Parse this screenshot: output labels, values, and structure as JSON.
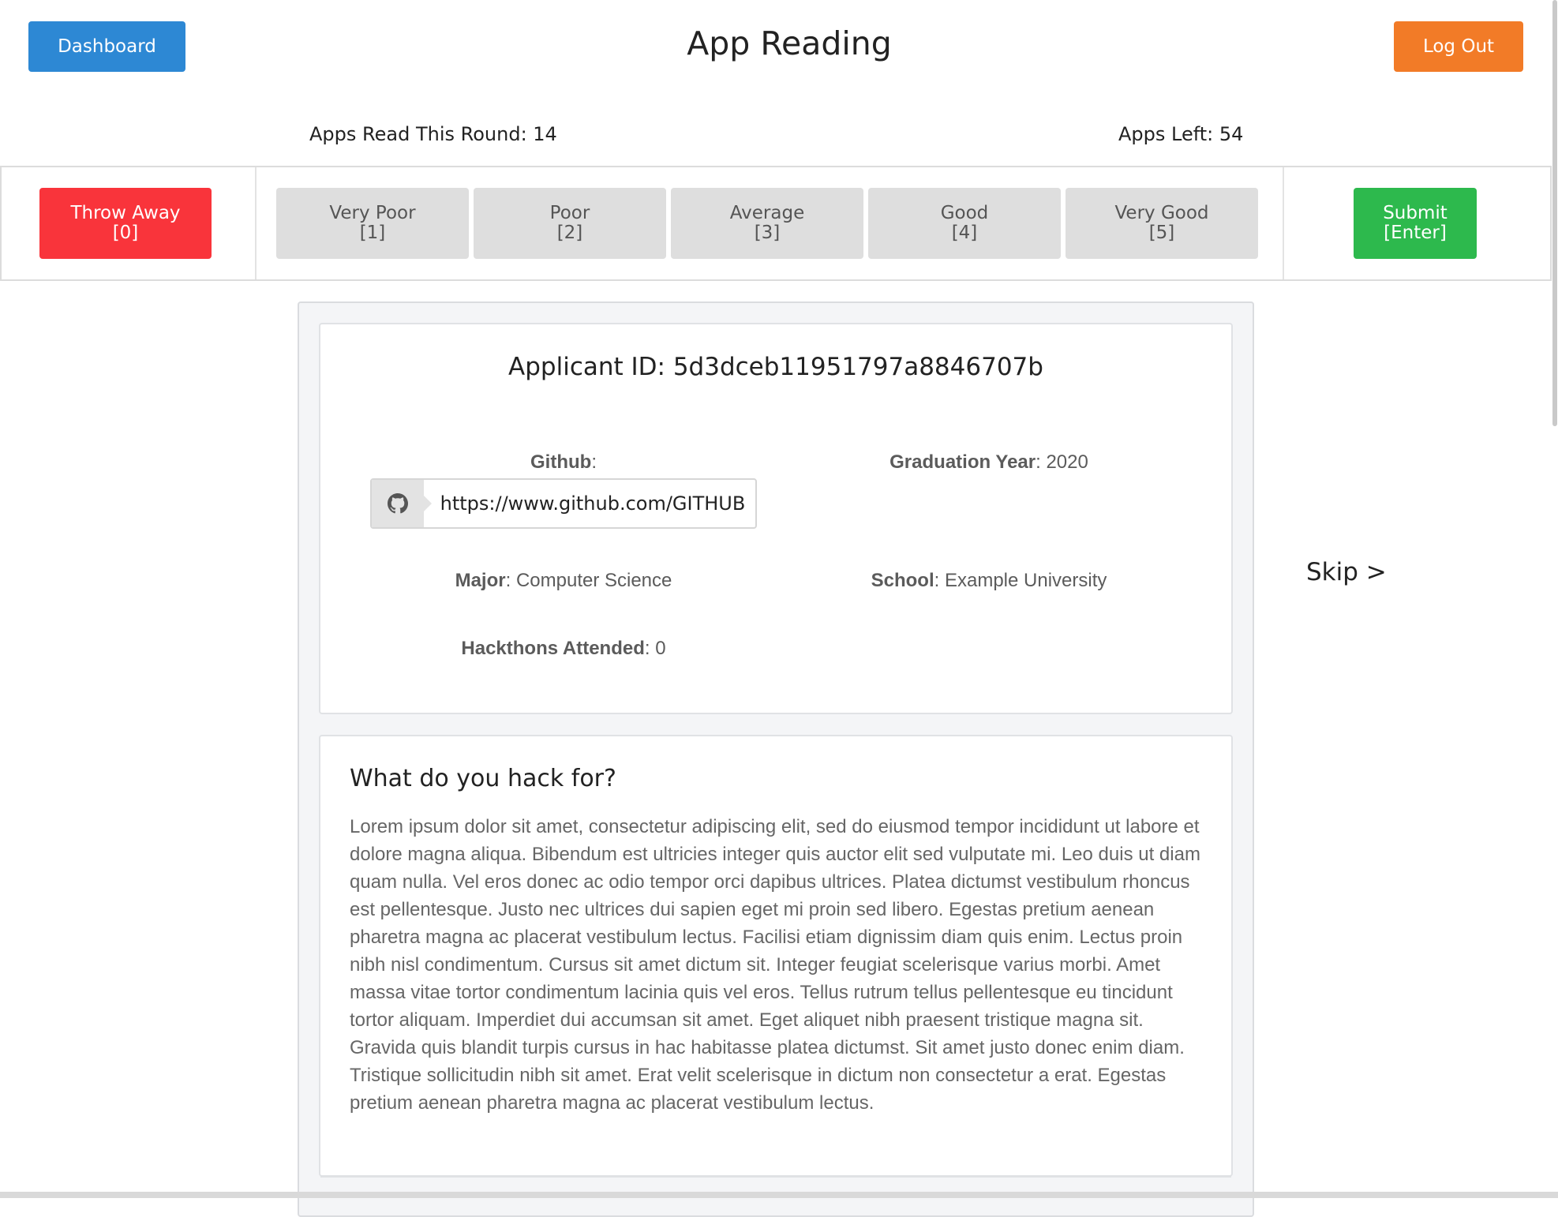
{
  "header": {
    "dashboard_label": "Dashboard",
    "title": "App Reading",
    "logout_label": "Log Out"
  },
  "stats": {
    "apps_read": "Apps Read This Round: 14",
    "apps_left": "Apps Left: 54"
  },
  "rating": {
    "throw_away": {
      "label": "Throw Away",
      "key": "[0]"
    },
    "very_poor": {
      "label": "Very Poor",
      "key": "[1]"
    },
    "poor": {
      "label": "Poor",
      "key": "[2]"
    },
    "average": {
      "label": "Average",
      "key": "[3]"
    },
    "good": {
      "label": "Good",
      "key": "[4]"
    },
    "very_good": {
      "label": "Very Good",
      "key": "[5]"
    },
    "submit": {
      "label": "Submit",
      "key": "[Enter]"
    }
  },
  "applicant": {
    "id_text": "Applicant ID: 5d3dceb11951797a8846707b",
    "github_label": "Github",
    "github_url": "https://www.github.com/GITHUB",
    "grad_year_label": "Graduation Year",
    "grad_year_value": "2020",
    "major_label": "Major",
    "major_value": "Computer Science",
    "school_label": "School",
    "school_value": "Example University",
    "hackathons_label": "Hackthons Attended",
    "hackathons_value": "0"
  },
  "skip_label": "Skip >",
  "essay": {
    "question": "What do you hack for?",
    "answer": "Lorem ipsum dolor sit amet, consectetur adipiscing elit, sed do eiusmod tempor incididunt ut labore et dolore magna aliqua. Bibendum est ultricies integer quis auctor elit sed vulputate mi. Leo duis ut diam quam nulla. Vel eros donec ac odio tempor orci dapibus ultrices. Platea dictumst vestibulum rhoncus est pellentesque. Justo nec ultrices dui sapien eget mi proin sed libero. Egestas pretium aenean pharetra magna ac placerat vestibulum lectus. Facilisi etiam dignissim diam quis enim. Lectus proin nibh nisl condimentum. Cursus sit amet dictum sit. Integer feugiat scelerisque varius morbi. Amet massa vitae tortor condimentum lacinia quis vel eros. Tellus rutrum tellus pellentesque eu tincidunt tortor aliquam. Imperdiet dui accumsan sit amet. Eget aliquet nibh praesent tristique magna sit. Gravida quis blandit turpis cursus in hac habitasse platea dictumst. Sit amet justo donec enim diam. Tristique sollicitudin nibh sit amet. Erat velit scelerisque in dictum non consectetur a erat. Egestas pretium aenean pharetra magna ac placerat vestibulum lectus."
  },
  "icons": {
    "github": "github-icon"
  },
  "colors": {
    "dashboard": "#2d88d4",
    "logout": "#f27b27",
    "throw_away": "#f9343b",
    "submit": "#2db94d",
    "rating_grey": "#dedede"
  }
}
